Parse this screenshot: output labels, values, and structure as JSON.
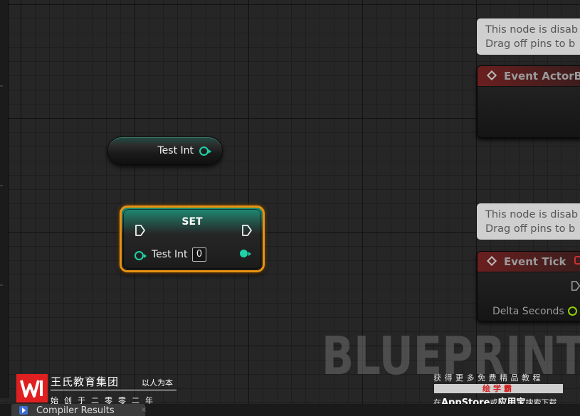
{
  "getter_node": {
    "label": "Test Int",
    "pin_color": "#1fd1a8"
  },
  "set_node": {
    "title": "SET",
    "pin_label": "Test Int",
    "value": "0",
    "border_color": "#e8930e"
  },
  "disabled_notice": {
    "line1": "This node is disab",
    "line2": "Drag off pins to b"
  },
  "events": [
    {
      "title": "Event ActorBe"
    },
    {
      "title": "Event Tick",
      "output_label": "Delta Seconds"
    }
  ],
  "watermark": "BLUEPRINT",
  "brand": {
    "name": "王氏教育集团",
    "slogan": "以人为本",
    "sub": "始创于二零零二年"
  },
  "promo": {
    "top": "获得更多免费精品教程",
    "bar": "绘学霸",
    "bottom_prefix": "在",
    "bottom_store": "AppStore",
    "bottom_or": "或",
    "bottom_app": "应用宝",
    "bottom_suffix": "搜索下载"
  },
  "bottom_tab": {
    "label": "Compiler Results",
    "close": "×"
  },
  "icons": [
    "exec-pin-icon",
    "data-pin-icon",
    "event-diamond-icon",
    "delegate-icon",
    "compiler-results-icon",
    "logo-icon",
    "close-icon"
  ]
}
